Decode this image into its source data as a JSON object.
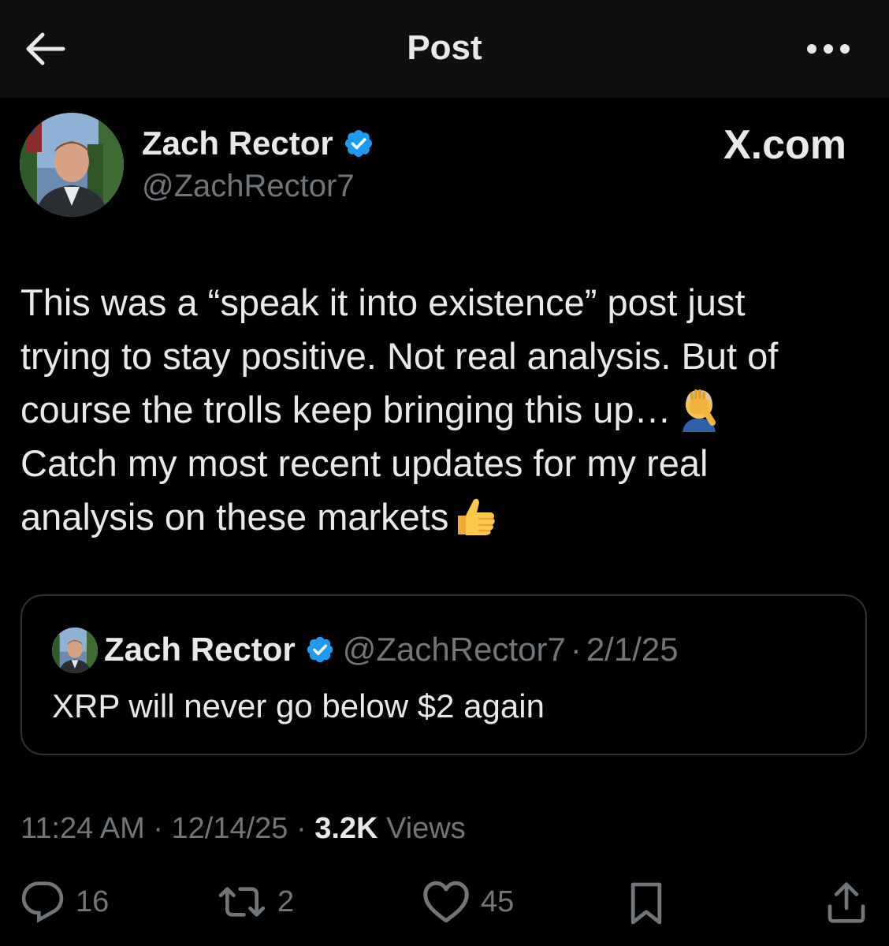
{
  "topbar": {
    "title": "Post"
  },
  "post": {
    "author_name": "Zach Rector",
    "author_handle": "@ZachRector7",
    "source_label": "X.com",
    "lines": [
      "This was a “speak it into existence” post just",
      "trying to stay positive. Not real analysis. But of",
      "course the trolls keep bringing this up…",
      "Catch my most recent updates for my real",
      "analysis on these markets"
    ],
    "emojis": [
      "face-palm-emoji",
      "thumbs-up-emoji"
    ]
  },
  "quote": {
    "author_name": "Zach Rector",
    "author_handle": "@ZachRector7",
    "separator": "·",
    "date": "2/1/25",
    "text": "XRP will never go below $2 again"
  },
  "meta": {
    "time": "11:24 AM",
    "separator": "·",
    "date": "12/14/25",
    "views_count": "3.2K",
    "views_label": "Views"
  },
  "actions": {
    "replies": "16",
    "reposts": "2",
    "likes": "45"
  },
  "colors": {
    "background": "#000000",
    "topbar": "#0f0f0f",
    "text": "#e7e9ea",
    "muted": "#71767b",
    "verified": "#1d9bf0",
    "border": "#2f3336"
  }
}
